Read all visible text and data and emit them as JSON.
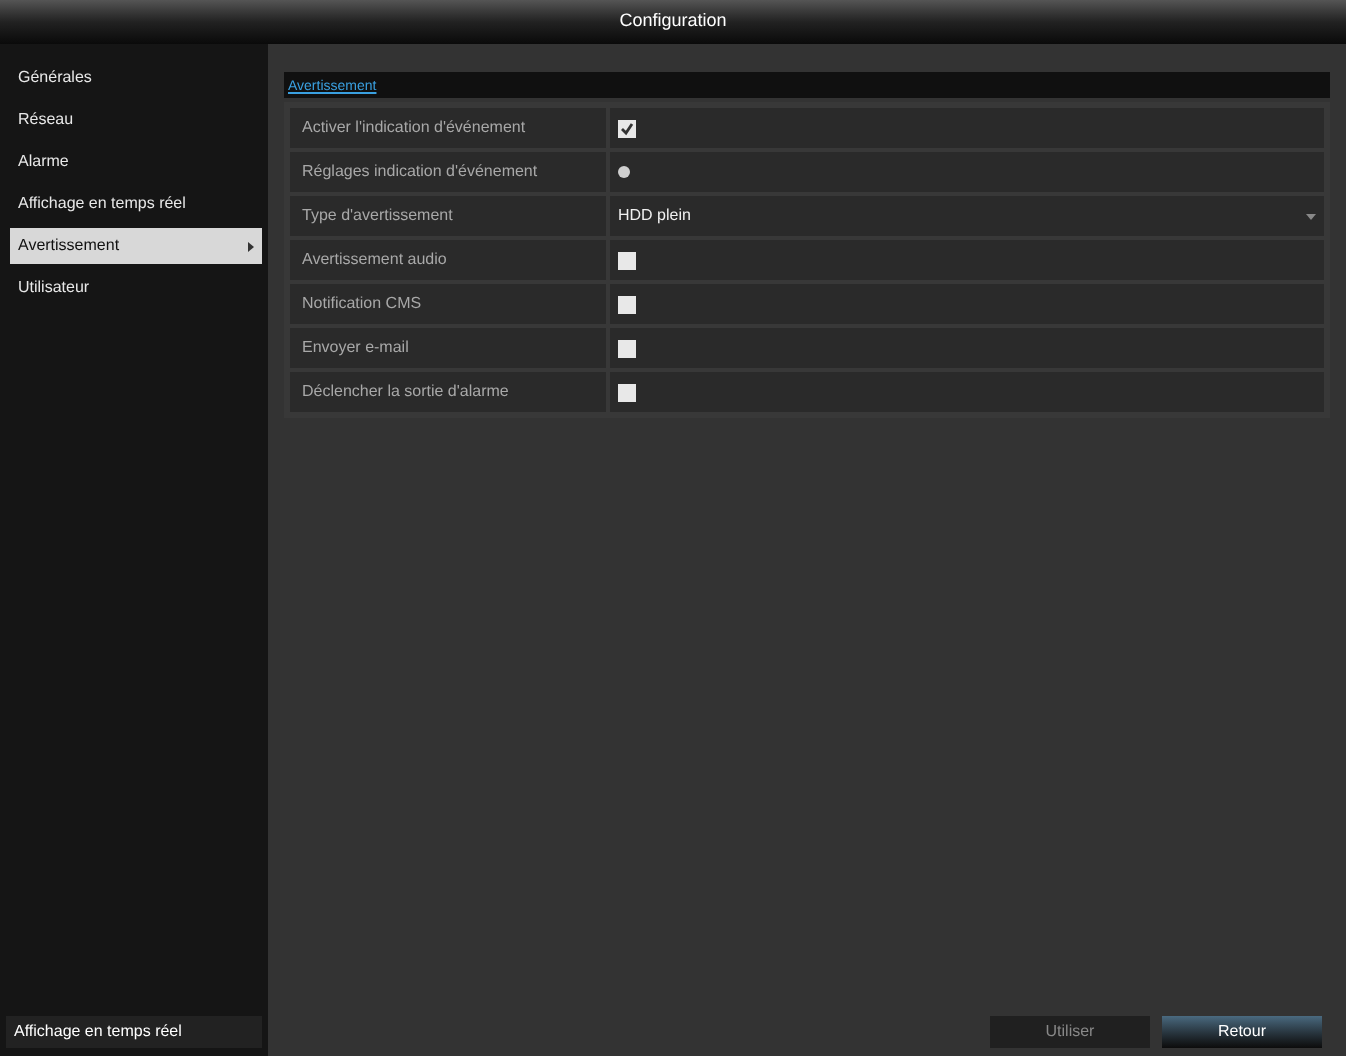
{
  "window": {
    "title": "Configuration"
  },
  "sidebar": {
    "items": [
      {
        "label": "Générales",
        "selected": false
      },
      {
        "label": "Réseau",
        "selected": false
      },
      {
        "label": "Alarme",
        "selected": false
      },
      {
        "label": "Affichage en temps réel",
        "selected": false
      },
      {
        "label": "Avertissement",
        "selected": true
      },
      {
        "label": "Utilisateur",
        "selected": false
      }
    ],
    "footer": "Affichage en temps réel"
  },
  "tabs": [
    {
      "label": "Avertissement",
      "selected": true
    }
  ],
  "settings": [
    {
      "kind": "checkbox",
      "label": "Activer l'indication d'événement",
      "checked": true
    },
    {
      "kind": "gear",
      "label": "Réglages indication d'événement"
    },
    {
      "kind": "select",
      "label": "Type d'avertissement",
      "value": "HDD plein"
    },
    {
      "kind": "checkbox",
      "label": "Avertissement audio",
      "checked": false
    },
    {
      "kind": "checkbox",
      "label": "Notification CMS",
      "checked": false
    },
    {
      "kind": "checkbox",
      "label": "Envoyer e-mail",
      "checked": false
    },
    {
      "kind": "checkbox",
      "label": "Déclencher la sortie d'alarme",
      "checked": false
    }
  ],
  "buttons": [
    {
      "label": "Utiliser",
      "disabled": true
    },
    {
      "label": "Retour",
      "disabled": false
    }
  ]
}
